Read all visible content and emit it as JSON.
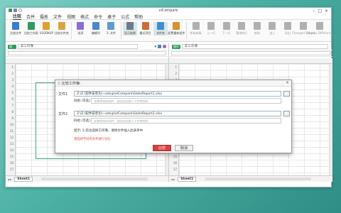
{
  "window": {
    "title": "xlCompare"
  },
  "menu": [
    "比较",
    "合并",
    "摄拣",
    "文件",
    "视图",
    "格式",
    "命令",
    "桌子",
    "公式",
    "帮助"
  ],
  "ribbon": [
    {
      "label": "比较文件",
      "icon": "compare-files-icon",
      "color": "#3a7bd5"
    },
    {
      "label": "比较工作表",
      "icon": "compare-sheets-icon",
      "color": "#2e9d5b"
    },
    {
      "label": "VLOOKUP",
      "icon": "vlookup-icon",
      "color": "#e0a030"
    },
    {
      "label": "比较文件夹",
      "icon": "compare-folder-icon",
      "color": "#d9a441"
    },
    {
      "label": "选项",
      "icon": "options-icon",
      "color": "#8a6fcf"
    },
    {
      "label": "编辑列",
      "icon": "edit-columns-icon",
      "color": "#4a88c7"
    },
    {
      "label": "3. 文件",
      "icon": "three-files-icon",
      "color": "#5e9bd1"
    },
    {
      "label": "显示结果",
      "icon": "show-results-icon",
      "color": "#6b7d8a"
    },
    {
      "label": "最近项目",
      "icon": "recent-items-icon",
      "color": "#cc6b3a"
    },
    {
      "label": "文件夹",
      "icon": "folder-icon",
      "color": "#3d8fcf"
    },
    {
      "label": "配置重新组件",
      "icon": "config-icon",
      "color": "#d88f2f"
    },
    {
      "label": "所有病毒",
      "icon": "all-changes-icon",
      "color": "#b0b0b0"
    },
    {
      "label": "上一行",
      "icon": "prev-row-icon",
      "color": "#b0b0b0"
    },
    {
      "label": "下一行",
      "icon": "next-row-icon",
      "color": "#b0b0b0"
    },
    {
      "label": "更改的行",
      "icon": "changed-rows-icon",
      "color": "#b0b0b0"
    },
    {
      "label": "修改",
      "icon": "modify-icon",
      "color": "#b0b0b0"
    },
    {
      "label": "进入",
      "icon": "enter-icon",
      "color": "#b0b0b0"
    },
    {
      "label": "导出",
      "icon": "export-icon",
      "color": "#b0b0b0"
    },
    {
      "label": "Changed Values",
      "icon": "changed-values-icon",
      "color": "#b0b0b0"
    },
    {
      "label": "Display Difference",
      "icon": "display-difference-icon",
      "color": "#b0b0b0"
    }
  ],
  "left_pane": {
    "tag": "操作",
    "path": "非工作簿",
    "sheet": "Sheet1"
  },
  "right_pane": {
    "tag": "操作",
    "path": "非工作簿",
    "sheet": "Sheet1"
  },
  "rows": [
    "1",
    "2",
    "3",
    "4",
    "5",
    "6",
    "7",
    "8",
    "9",
    "10",
    "11",
    "12",
    "13",
    "14",
    "15",
    "16",
    "17"
  ],
  "dialog": {
    "title": "比较工作簿:",
    "file1_label": "文件1",
    "file1_value": "Z:\\Z:\\软件安装包\\~setup\\xlCompare\\SalesReport1.xlsx",
    "pwd1_label": "码组 (可选)",
    "pwd1_placeholder": "如果受密码保护，请在此处输入工作簿密码",
    "file2_label": "文件2",
    "file2_value": "Z:\\Z:\\软件安装包\\~setup\\xlCompare\\SalesReport2.xlsx",
    "pwd2_label": "码组 (可选)",
    "pwd2_placeholder": "如果受密码保护，请在此处输入工作簿密码",
    "hint": "提示: 2.您也选择工作簿，请将文件插入此表单中",
    "error": "请选择不同的文件进行对比",
    "ok_label": "比较",
    "cancel_label": "取消"
  }
}
